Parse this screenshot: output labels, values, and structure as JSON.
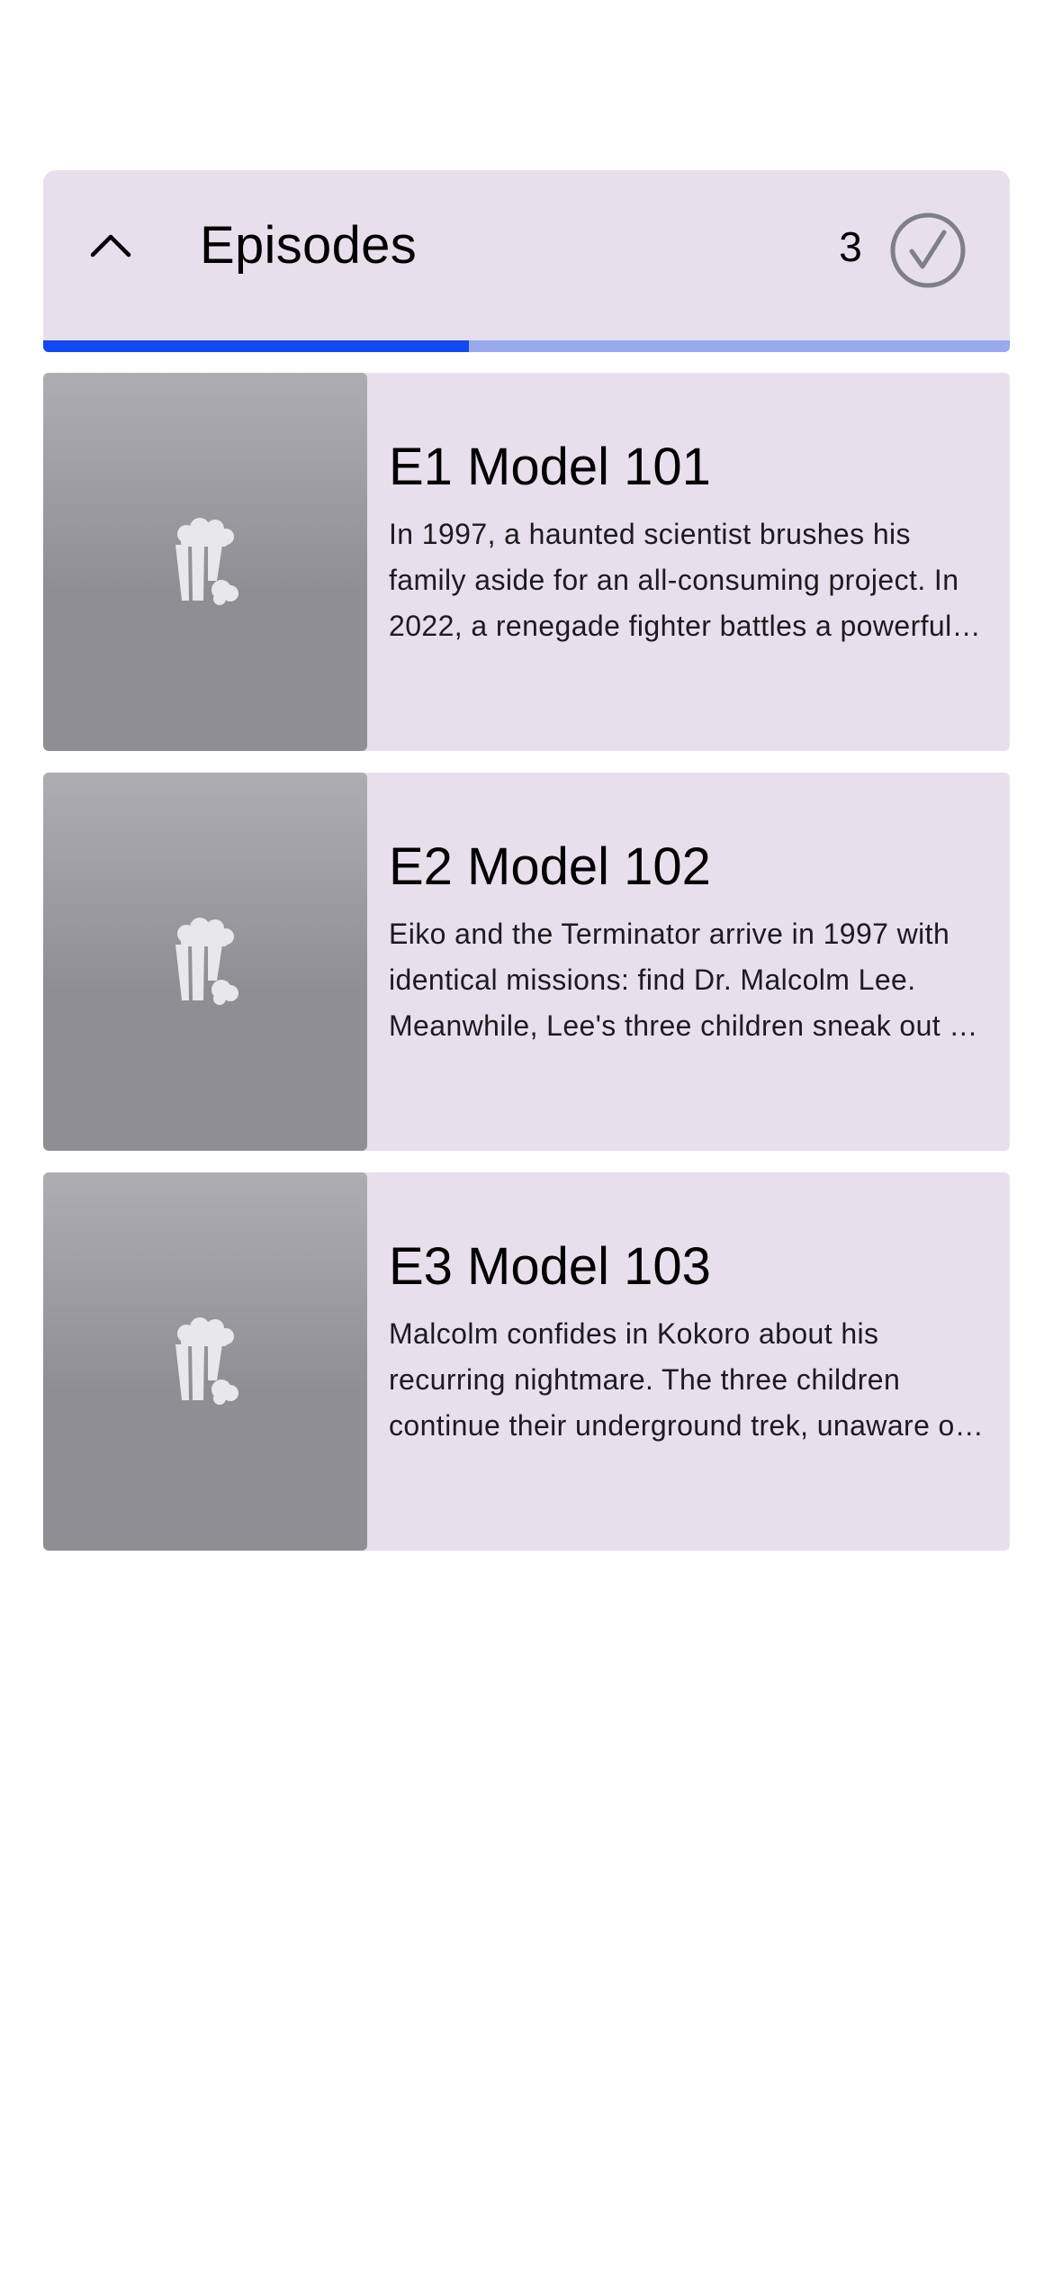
{
  "section": {
    "title": "Episodes",
    "count": "3",
    "progress_fraction": 0.44,
    "progress_color": "#1449f0",
    "track_color": "#99a9ee",
    "background_color": "#e7e0ec",
    "icons": {
      "toggle": "chevron-up-icon",
      "status": "check-circle-icon"
    }
  },
  "episodes": [
    {
      "title": "E1 Model 101",
      "description": "In 1997, a haunted scientist brushes his family aside for an all-consuming project. In 2022, a renegade fighter battles a powerful foe.",
      "thumbnail_icon": "popcorn-icon"
    },
    {
      "title": "E2 Model 102",
      "description": "Eiko and the Terminator arrive in 1997 with identical missions: find Dr. Malcolm Lee. Meanwhile, Lee's three children sneak out of the house.",
      "thumbnail_icon": "popcorn-icon"
    },
    {
      "title": "E3 Model 103",
      "description": "Malcolm confides in Kokoro about his recurring nightmare. The three children continue their underground trek, unaware of what awaits them.",
      "thumbnail_icon": "popcorn-icon"
    }
  ]
}
